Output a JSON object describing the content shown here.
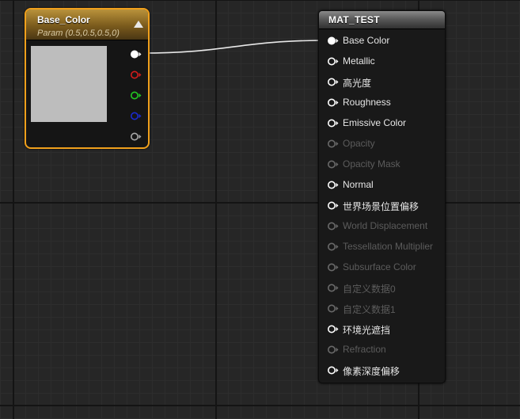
{
  "param_node": {
    "title": "Base_Color",
    "subtitle": "Param (0.5,0.5,0.5,0)",
    "swatch_color": "#bdbdbd",
    "border_color": "#f0a01c",
    "outputs": [
      {
        "name": "output-rgb-pin",
        "color": "#ffffff",
        "filled": true
      },
      {
        "name": "output-r-pin",
        "color": "#d21c1c",
        "filled": false
      },
      {
        "name": "output-g-pin",
        "color": "#22c822",
        "filled": false
      },
      {
        "name": "output-b-pin",
        "color": "#1a2ad0",
        "filled": false
      },
      {
        "name": "output-a-pin",
        "color": "#a8a8a8",
        "filled": false
      }
    ]
  },
  "material_node": {
    "title": "MAT_TEST",
    "inputs": [
      {
        "label": "Base Color",
        "enabled": true,
        "connected": true
      },
      {
        "label": "Metallic",
        "enabled": true,
        "connected": false
      },
      {
        "label": "高光度",
        "enabled": true,
        "connected": false
      },
      {
        "label": "Roughness",
        "enabled": true,
        "connected": false
      },
      {
        "label": "Emissive Color",
        "enabled": true,
        "connected": false
      },
      {
        "label": "Opacity",
        "enabled": false,
        "connected": false
      },
      {
        "label": "Opacity Mask",
        "enabled": false,
        "connected": false
      },
      {
        "label": "Normal",
        "enabled": true,
        "connected": false
      },
      {
        "label": "世界场景位置偏移",
        "enabled": true,
        "connected": false
      },
      {
        "label": "World Displacement",
        "enabled": false,
        "connected": false
      },
      {
        "label": "Tessellation Multiplier",
        "enabled": false,
        "connected": false
      },
      {
        "label": "Subsurface Color",
        "enabled": false,
        "connected": false
      },
      {
        "label": "自定义数据0",
        "enabled": false,
        "connected": false
      },
      {
        "label": "自定义数据1",
        "enabled": false,
        "connected": false
      },
      {
        "label": "环境光遮挡",
        "enabled": true,
        "connected": false
      },
      {
        "label": "Refraction",
        "enabled": false,
        "connected": false
      },
      {
        "label": "像素深度偏移",
        "enabled": true,
        "connected": false
      }
    ]
  },
  "wire_color": "#e8e8e8"
}
